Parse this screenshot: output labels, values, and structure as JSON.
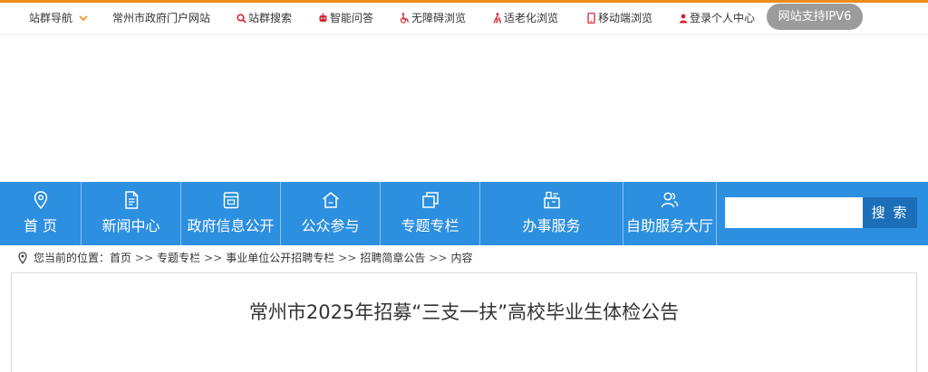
{
  "topbar": {
    "site_nav": "站群导航",
    "portal": "常州市政府门户网站",
    "search": "站群搜索",
    "qa": "智能问答",
    "accessible": "无障碍浏览",
    "elderly": "适老化浏览",
    "mobile": "移动端浏览",
    "login": "登录个人中心",
    "ipv6": "网站支持IPV6"
  },
  "nav": {
    "items": [
      {
        "label": "首 页",
        "icon": "location-pin-icon"
      },
      {
        "label": "新闻中心",
        "icon": "document-icon"
      },
      {
        "label": "政府信息公开",
        "icon": "info-box-icon"
      },
      {
        "label": "公众参与",
        "icon": "house-icon"
      },
      {
        "label": "专题专栏",
        "icon": "layers-icon"
      },
      {
        "label": "办事服务",
        "icon": "service-hall-icon"
      },
      {
        "label": "自助服务大厅",
        "icon": "users-icon"
      }
    ],
    "search_placeholder": "",
    "search_button": "搜 索"
  },
  "breadcrumb": {
    "prefix": "您当前的位置：",
    "items": [
      "首页",
      "专题专栏",
      "事业单位公开招聘专栏",
      "招聘简章公告",
      "内容"
    ],
    "separator": ">>"
  },
  "article": {
    "title": "常州市2025年招募“三支一扶”高校毕业生体检公告"
  },
  "colors": {
    "accent_orange": "#f08a1c",
    "nav_blue": "#2d8fe0",
    "button_blue": "#1a6fb8",
    "icon_red": "#d9232d"
  }
}
